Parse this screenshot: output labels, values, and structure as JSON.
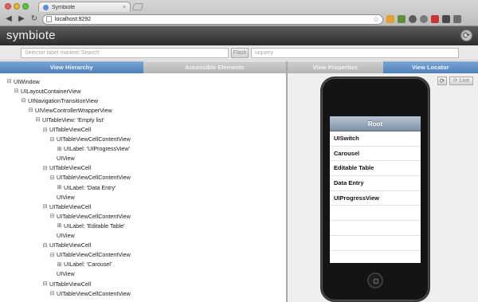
{
  "browser": {
    "tab_title": "Symbiote",
    "tab_close": "×",
    "url": "localhost:9292",
    "back_icon": "back-arrow-icon",
    "forward_icon": "forward-arrow-icon",
    "reload_icon": "reload-icon"
  },
  "app": {
    "title": "symbiote",
    "refresh_icon": "refresh-icon"
  },
  "search": {
    "selector_placeholder": "Selector label marked:'Search'",
    "flash_label": "Flash",
    "uiquery_placeholder": "uiquery"
  },
  "left_tabs": [
    {
      "label": "View Hierarchy",
      "active": true
    },
    {
      "label": "Accessible Elements",
      "active": false
    }
  ],
  "right_tabs": [
    {
      "label": "View Properties",
      "active": false
    },
    {
      "label": "View Locator",
      "active": true
    }
  ],
  "hierarchy": [
    {
      "depth": 0,
      "toggle": "⊟",
      "label": "UIWindow"
    },
    {
      "depth": 1,
      "toggle": "⊟",
      "label": "UILayoutContainerView"
    },
    {
      "depth": 2,
      "toggle": "⊟",
      "label": "UINavigationTransitionView"
    },
    {
      "depth": 3,
      "toggle": "⊟",
      "label": "UIViewControllerWrapperView"
    },
    {
      "depth": 4,
      "toggle": "⊟",
      "label": "UITableView: 'Empty list'"
    },
    {
      "depth": 5,
      "toggle": "⊟",
      "label": "UITableViewCell"
    },
    {
      "depth": 6,
      "toggle": "⊟",
      "label": "UITableViewCellContentView"
    },
    {
      "depth": 7,
      "toggle": "⊞",
      "label": "UILabel: 'UIProgressView'"
    },
    {
      "depth": 6,
      "toggle": "",
      "label": "UIView"
    },
    {
      "depth": 5,
      "toggle": "⊟",
      "label": "UITableViewCell"
    },
    {
      "depth": 6,
      "toggle": "⊟",
      "label": "UITableViewCellContentView"
    },
    {
      "depth": 7,
      "toggle": "⊞",
      "label": "UILabel: 'Data Entry'"
    },
    {
      "depth": 6,
      "toggle": "",
      "label": "UIView"
    },
    {
      "depth": 5,
      "toggle": "⊟",
      "label": "UITableViewCell"
    },
    {
      "depth": 6,
      "toggle": "⊟",
      "label": "UITableViewCellContentView"
    },
    {
      "depth": 7,
      "toggle": "⊞",
      "label": "UILabel: 'Editable Table'"
    },
    {
      "depth": 6,
      "toggle": "",
      "label": "UIView"
    },
    {
      "depth": 5,
      "toggle": "⊟",
      "label": "UITableViewCell"
    },
    {
      "depth": 6,
      "toggle": "⊟",
      "label": "UITableViewCellContentView"
    },
    {
      "depth": 7,
      "toggle": "⊞",
      "label": "UILabel: 'Carousel'"
    },
    {
      "depth": 6,
      "toggle": "",
      "label": "UIView"
    },
    {
      "depth": 5,
      "toggle": "⊟",
      "label": "UITableViewCell"
    },
    {
      "depth": 6,
      "toggle": "⊟",
      "label": "UITableViewCellContentView"
    }
  ],
  "locator": {
    "refresh_icon": "refresh-icon",
    "live_label": "Live",
    "nav_title": "Root",
    "cells": [
      "UISwitch",
      "Carousel",
      "Editable Table",
      "Data Entry",
      "UIProgressView",
      "",
      "",
      "",
      ""
    ]
  },
  "colors": {
    "active_tab": "#4f7fb9",
    "inactive_tab": "#b3b3b3",
    "header_dark": "#2c2c2c"
  }
}
